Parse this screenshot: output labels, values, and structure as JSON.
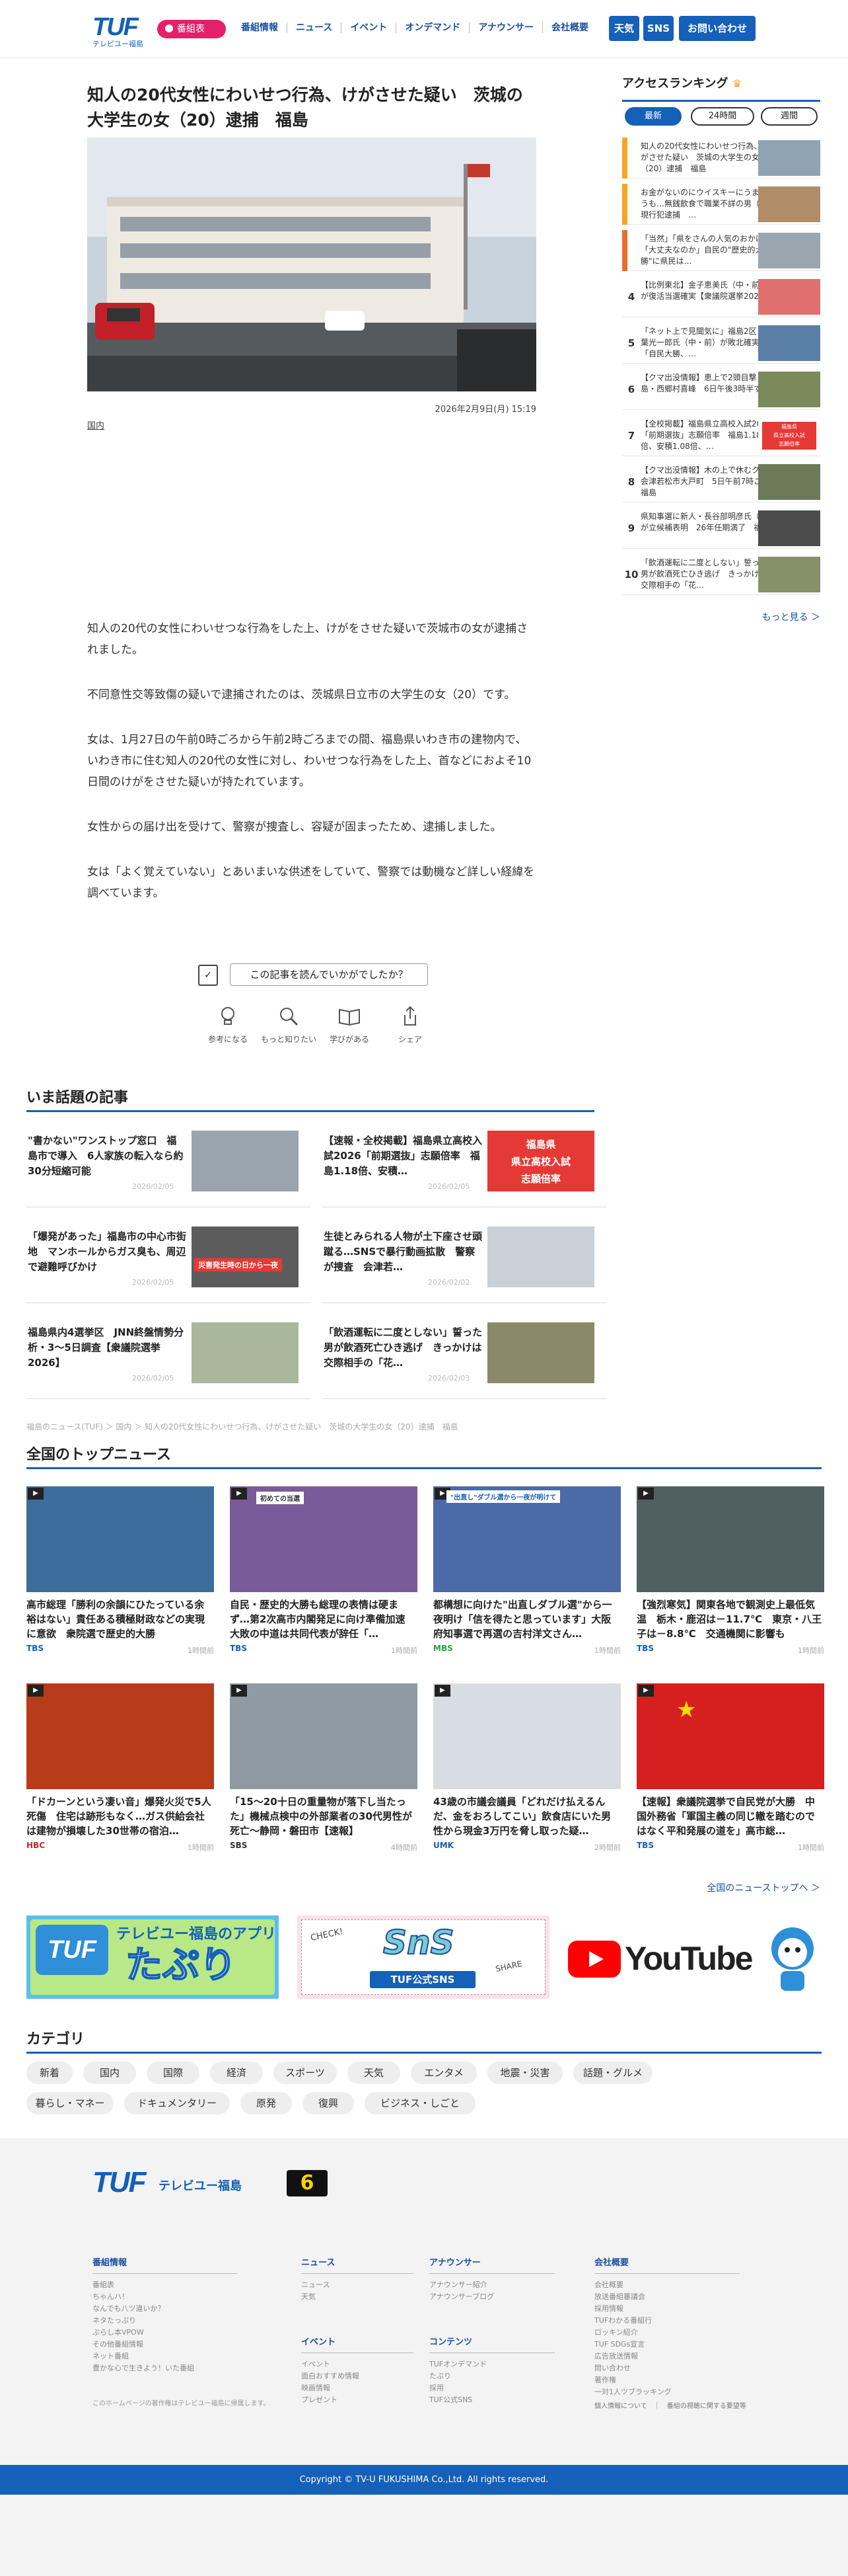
{
  "header": {
    "logo": "TUF",
    "logo_sub": "テレビユー福島",
    "program_badge": "番組表",
    "nav": [
      "番組情報",
      "ニュース",
      "イベント",
      "オンデマンド",
      "アナウンサー",
      "会社概要"
    ],
    "btn_weather": "天気",
    "btn_sns": "SNS",
    "btn_contact": "お問い合わせ"
  },
  "article": {
    "title": "知人の20代女性にわいせつ行為、けがさせた疑い　茨城の大学生の女（20）逮捕　福島",
    "date": "2026年2月9日(月) 15:19",
    "category": "国内",
    "paragraphs": [
      "知人の20代の女性にわいせつな行為をした上、けがをさせた疑いで茨城市の女が逮捕されました。",
      "不同意性交等致傷の疑いで逮捕されたのは、茨城県日立市の大学生の女（20）です。",
      "女は、1月27日の午前0時ごろから午前2時ごろまでの間、福島県いわき市の建物内で、いわき市に住む知人の20代の女性に対し、わいせつな行為をした上、首などにおよそ10日間のけがをさせた疑いが持たれています。",
      "女性からの届け出を受けて、警察が捜査し、容疑が固まったため、逮捕しました。",
      "女は「よく覚えていない」とあいまいな供述をしていて、警察では動機など詳しい経緯を調べています。"
    ],
    "survey_question": "この記事を読んでいかがでしたか？",
    "reactions": [
      "参考になる",
      "もっと知りたい",
      "学びがある",
      "シェア"
    ]
  },
  "sidebar": {
    "ranking_title": "アクセスランキング",
    "tabs": [
      "最新",
      "24時間",
      "週間"
    ],
    "items": [
      {
        "rank": "1",
        "text": "知人の20代女性にわいせつ行為、けがさせた疑い　茨城の大学生の女（20）逮捕　福島"
      },
      {
        "rank": "2",
        "text": "お金がないのにウイスキーにうまそうも…無銭飲食で職業不詳の男（49）現行犯逮捕　…"
      },
      {
        "rank": "3",
        "text": "「当然」「県をさんの人気のおかげ」「大丈夫なのか」自民の\"歴史的大勝\"に県民は…"
      },
      {
        "rank": "4",
        "text": "【比例東北】金子恵美氏（中・前）が復活当選確実【衆議院選挙2026】"
      },
      {
        "rank": "5",
        "text": "「ネット上で見聞気に」福島2区　玄葉光一郎氏（中・前）が敗北確実「自民大勝、…"
      },
      {
        "rank": "6",
        "text": "【クマ出没情報】恵上で2頭目撃　福島・西郷村喜峰　6日午後3時半すぎ"
      },
      {
        "rank": "7",
        "text": "【全校掲載】福島県立高校入試2026「前期選抜」志願倍率　福島1.18倍、安積1.08倍、…"
      },
      {
        "rank": "8",
        "text": "【クマ出没情報】木の上で休むクマ　会津若松市大戸町　5日午前7時ごろ　福島"
      },
      {
        "rank": "9",
        "text": "県知事選に新人・長谷部明彦氏（58）が立候補表明　26年任期満了　福島"
      },
      {
        "rank": "10",
        "text": "「飲酒運転に二度としない」誓った男が飲酒死亡ひき逃げ　きっかけは交際相手の「花…"
      }
    ],
    "rank7_badge": [
      "福島県",
      "県立高校入試",
      "志願倍率"
    ],
    "more": "もっと見る ＞"
  },
  "trending": {
    "title": "いま話題の記事",
    "items": [
      {
        "text": "\"書かない\"ワンストップ窓口　福島市で導入　6人家族の転入なら約30分短縮可能",
        "date": "2026/02/05"
      },
      {
        "text": "【速報・全校掲載】福島県立高校入試2026「前期選抜」志願倍率　福島1.18倍、安積…",
        "date": "2026/02/05"
      },
      {
        "text": "「爆発があった」福島市の中心市街地　マンホールからガス臭も、周辺で避難呼びかけ",
        "date": "2026/02/05"
      },
      {
        "text": "生徒とみられる人物が土下座させ頭蹴る…SNSで暴行動画拡散　警察が捜査　会津若…",
        "date": "2026/02/02"
      },
      {
        "text": "福島県内4選挙区　JNN終盤情勢分析・3～5日調査【衆議院選挙2026】",
        "date": "2026/02/05"
      },
      {
        "text": "「飲酒運転に二度としない」誓った男が飲酒死亡ひき逃げ　きっかけは交際相手の「花…",
        "date": "2026/02/03"
      }
    ],
    "badge": [
      "福島県",
      "県立高校入試",
      "志願倍率"
    ],
    "thumb_caption": "災害発生時の日から一夜"
  },
  "breadcrumb": "福島のニュース(TUF) ＞ 国内 ＞ 知人の20代女性にわいせつ行為、けがさせた疑い　茨城の大学生の女（20）逮捕　福島",
  "national": {
    "title": "全国のトップニュース",
    "items": [
      {
        "text": "高市総理「勝利の余韻にひたっている余裕はない」責任ある積極財政などの実現に意欲　衆院選で歴史的大勝",
        "src": "TBS",
        "time": "1時間前"
      },
      {
        "text": "自民・歴史的大勝も総理の表情は硬まず…第2次高市内閣発足に向け準備加速　大敗の中道は共同代表が辞任「…",
        "src": "TBS",
        "time": "1時間前"
      },
      {
        "text": "都構想に向けた\"出直しダブル選\"から一夜明け「信を得たと思っています」大阪府知事選で再選の吉村洋文さん…",
        "src": "MBS",
        "time": "1時間前"
      },
      {
        "text": "【強烈寒気】関東各地で観測史上最低気温　栃木・鹿沼は－11.7℃　東京・八王子は－8.8℃　交通機関に影響も",
        "src": "TBS",
        "time": "1時間前"
      },
      {
        "text": "「ドカーンという凄い音」爆発火災で5人死傷　住宅は跡形もなく…ガス供給会社は建物が損壊した30世帯の宿泊…",
        "src": "HBC",
        "time": "1時間前"
      },
      {
        "text": "「15～20十日の重量物が落下し当たった」機械点検中の外部業者の30代男性が死亡～静岡・磐田市【速報】",
        "src": "SBS",
        "time": "4時間前"
      },
      {
        "text": "43歳の市議会議員「どれだけ払えるんだ、金をおろしてこい」飲食店にいた男性から現金3万円を脅し取った疑…",
        "src": "UMK",
        "time": "2時間前"
      },
      {
        "text": "【速報】衆議院選挙で自民党が大勝　中国外務省「軍国主義の同じ轍を踏むのではなく平和発展の道を」高市総…",
        "src": "TBS",
        "time": "1時間前"
      }
    ],
    "thumb1_caption": "\"出直し\"ダブル選から一夜が明けて",
    "thumb2_caption": "初めての当選",
    "more": "全国のニューストップへ ＞"
  },
  "banners": {
    "app_name": "たぷり",
    "app_sub": "テレビユー福島のアプリ",
    "sns_check": "CHECK!",
    "sns_title": "SnS",
    "sns_sub": "TUF公式SNS",
    "sns_share": "SHARE",
    "youtube": "YouTube"
  },
  "categories": {
    "title": "カテゴリ",
    "chips": [
      "新着",
      "国内",
      "国際",
      "経済",
      "スポーツ",
      "天気",
      "エンタメ",
      "地震・災害",
      "話題・グルメ",
      "暮らし・マネー",
      "ドキュメンタリー",
      "原発",
      "復興",
      "ビジネス・しごと"
    ]
  },
  "footer": {
    "logo": "TUF",
    "logo_sub": "テレビユー福島",
    "ch": "6",
    "cols": [
      {
        "head": "番組情報",
        "links": [
          "番組表",
          "ちゃんハ！",
          "なんでも八ツ違いか？",
          "ネタたっぷり",
          "ぶらし本VPOW",
          "その他番組情報",
          "ネット番組",
          "豊かな心で生きよう！いた番組"
        ]
      },
      {
        "head": "ニュース",
        "links": [
          "ニュース",
          "天気"
        ]
      },
      {
        "head": "イベント",
        "links": [
          "イベント",
          "面白おすすめ情報",
          "映画情報",
          "プレゼント"
        ]
      },
      {
        "head": "アナウンサー",
        "links": [
          "アナウンサー紹介",
          "アナウンサーブログ"
        ]
      },
      {
        "head": "コンテンツ",
        "links": [
          "TUFオンデマンド",
          "たぷり",
          "採用",
          "TUF公式SNS"
        ]
      },
      {
        "head": "会社概要",
        "links": [
          "会社概要",
          "放送番組審議会",
          "採用情報",
          "TUFわかる番組行",
          "ロッキン紹介",
          "TUF SDGs宣言",
          "広告放送情報",
          "問い合わせ",
          "著作権",
          "一対1人ツブラッキング"
        ]
      }
    ],
    "note": "このホームページの著作権はテレビユー福島に帰属します。",
    "policy": "個人情報について　｜　番組の視聴に関する要望等",
    "copyright": "Copyright © TV-U FUKUSHIMA Co.,Ltd. All rights reserved."
  },
  "colors": {
    "brand": "#1560b8",
    "pink": "#e5206a",
    "red": "#e53935",
    "rank_top": "#f5a623"
  }
}
